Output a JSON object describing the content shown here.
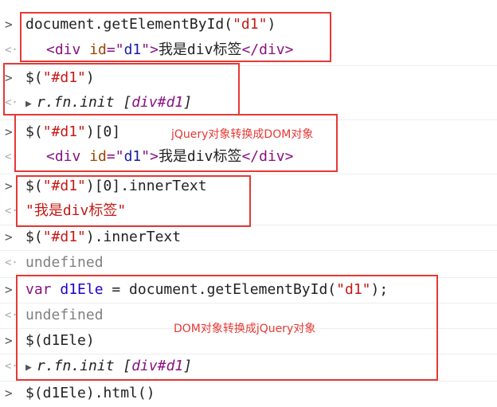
{
  "lines": [
    {
      "prompt": ">",
      "parts": [
        "document.getElementById(",
        "\"d1\"",
        ")"
      ]
    },
    {
      "prompt": "<·",
      "parts": [
        "<div ",
        "id",
        "=\"",
        "d1",
        "\"",
        ">",
        "我是div标签",
        "</div>"
      ]
    },
    {
      "prompt": ">",
      "parts": [
        "$(",
        "\"#d1\"",
        ")"
      ]
    },
    {
      "prompt": "<·",
      "parts": [
        "▶",
        "r.fn.init [",
        "div#d1",
        "]"
      ]
    },
    {
      "prompt": ">",
      "parts": [
        "$(",
        "\"#d1\"",
        ")[0]"
      ]
    },
    {
      "prompt": "<·",
      "parts": [
        "<div ",
        "id",
        "=\"",
        "d1",
        "\"",
        ">",
        "我是div标签",
        "</div>"
      ]
    },
    {
      "prompt": ">",
      "parts": [
        "$(",
        "\"#d1\"",
        ")[0].innerText"
      ]
    },
    {
      "prompt": "<·",
      "parts": [
        "\"我是div标签\""
      ]
    },
    {
      "prompt": ">",
      "parts": [
        "$(",
        "\"#d1\"",
        ").innerText"
      ]
    },
    {
      "prompt": "<·",
      "parts": [
        "undefined"
      ]
    },
    {
      "prompt": ">",
      "parts": [
        "var ",
        "d1Ele",
        " = document.getElementById(",
        "\"d1\"",
        ");"
      ]
    },
    {
      "prompt": "<·",
      "parts": [
        "undefined"
      ]
    },
    {
      "prompt": ">",
      "parts": [
        "$(d1Ele)"
      ]
    },
    {
      "prompt": "<·",
      "parts": [
        "▶",
        "r.fn.init [",
        "div#d1",
        "]"
      ]
    },
    {
      "prompt": ">",
      "parts": [
        "$(d1Ele).html()"
      ]
    }
  ],
  "annotations": {
    "note1": "jQuery对象转换成DOM对象",
    "note2": "DOM对象转换成jQuery对象"
  },
  "colors": {
    "annotation": "#e53935",
    "tag": "#881280",
    "attr": "#994500",
    "string": "#c41a16"
  }
}
